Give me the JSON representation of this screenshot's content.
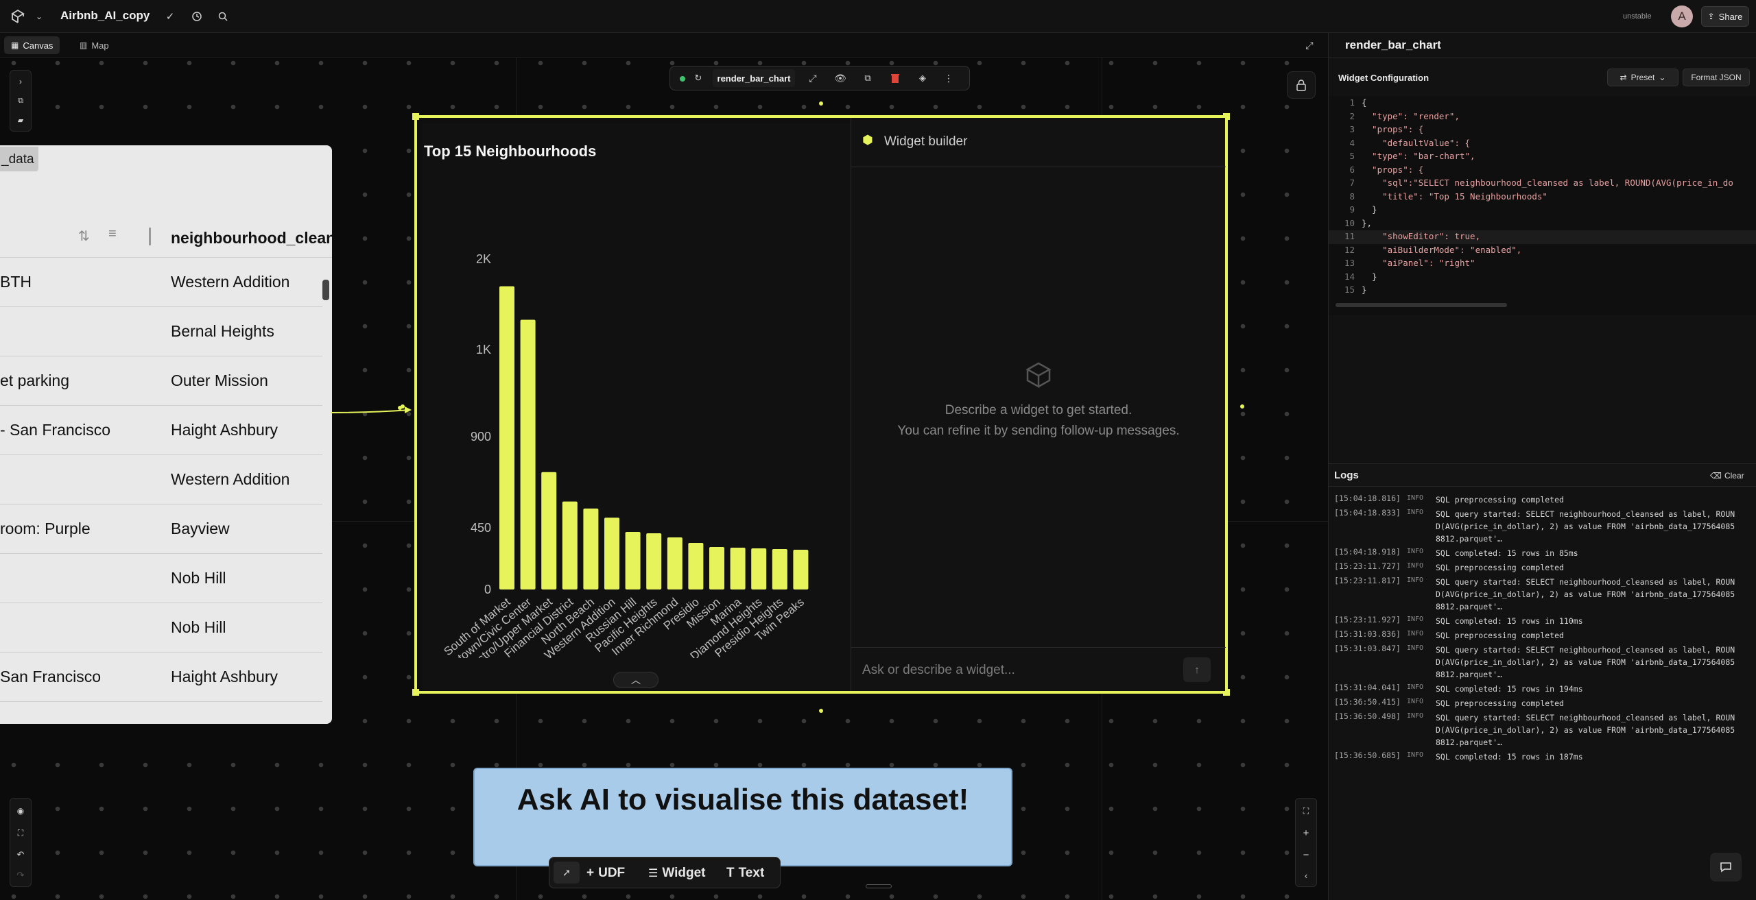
{
  "app": {
    "project_name": "Airbnb_AI_copy",
    "status_tag": "unstable",
    "avatar_letter": "A",
    "share_label": "Share"
  },
  "subbar": {
    "tabs": [
      {
        "label": "Canvas"
      },
      {
        "label": "Map"
      }
    ]
  },
  "table_card": {
    "title_fragment": "_data",
    "column_header": "neighbourhood_clean",
    "rows": [
      {
        "left": "BTH",
        "neighbourhood": "Western Addition"
      },
      {
        "left": "",
        "neighbourhood": "Bernal Heights"
      },
      {
        "left": "et parking",
        "neighbourhood": "Outer Mission"
      },
      {
        "left": "- San Francisco",
        "neighbourhood": "Haight Ashbury"
      },
      {
        "left": "",
        "neighbourhood": "Western Addition"
      },
      {
        "left": "room: Purple",
        "neighbourhood": "Bayview"
      },
      {
        "left": "",
        "neighbourhood": "Nob Hill"
      },
      {
        "left": "",
        "neighbourhood": "Nob Hill"
      },
      {
        "left": " San Francisco",
        "neighbourhood": "Haight Ashbury"
      }
    ]
  },
  "widget_toolbar": {
    "name": "render_bar_chart"
  },
  "chart_data": {
    "type": "bar",
    "title": "Top 15 Neighbourhoods",
    "categories": [
      "South of Market",
      "Downtown/Civic Center",
      "Castro/Upper Market",
      "Financial District",
      "North Beach",
      "Western Addition",
      "Russian Hill",
      "Pacific Heights",
      "Inner Richmond",
      "Presidio",
      "Mission",
      "Marina",
      "Diamond Heights",
      "Presidio Heights",
      "Twin Peaks"
    ],
    "values": [
      1700,
      1330,
      725,
      580,
      545,
      500,
      420,
      410,
      380,
      340,
      310,
      305,
      300,
      295,
      290
    ],
    "y_ticks": [
      {
        "label": "2K"
      },
      {
        "label": "1K"
      },
      {
        "label": "900"
      },
      {
        "label": "450"
      },
      {
        "label": "0"
      }
    ],
    "bar_color": "#e6f35a"
  },
  "builder": {
    "title": "Widget builder",
    "empty_line1": "Describe a widget to get started.",
    "empty_line2": "You can refine it by sending follow-up messages.",
    "input_placeholder": "Ask or describe a widget..."
  },
  "banner": {
    "text": "Ask AI to visualise this dataset!"
  },
  "bottom_tools": [
    {
      "label": "UDF"
    },
    {
      "label": "Widget"
    },
    {
      "label": "Text"
    }
  ],
  "right_panel": {
    "title": "render_bar_chart",
    "config_label": "Widget Configuration",
    "preset_label": "Preset",
    "format_label": "Format JSON",
    "code_lines": [
      "{",
      "  \"type\": \"render\",",
      "  \"props\": {",
      "    \"defaultValue\": {",
      "  \"type\": \"bar-chart\",",
      "  \"props\": {",
      "    \"sql\":\"SELECT neighbourhood_cleansed as label, ROUND(AVG(price_in_do",
      "    \"title\": \"Top 15 Neighbourhoods\"",
      "  }",
      "},",
      "    \"showEditor\": true,",
      "    \"aiBuilderMode\": \"enabled\",",
      "    \"aiPanel\": \"right\"",
      "  }",
      "}"
    ],
    "logs_label": "Logs",
    "clear_label": "Clear",
    "logs": [
      {
        "ts": "[15:04:18.816]",
        "level": "INFO",
        "msg": "SQL preprocessing completed"
      },
      {
        "ts": "[15:04:18.833]",
        "level": "INFO",
        "msg": "SQL query started: SELECT neighbourhood_cleansed as label, ROUND(AVG(price_in_dollar), 2) as value FROM 'airbnb_data_1775640858812.parquet'…"
      },
      {
        "ts": "[15:04:18.918]",
        "level": "INFO",
        "msg": "SQL completed: 15 rows in 85ms"
      },
      {
        "ts": "[15:23:11.727]",
        "level": "INFO",
        "msg": "SQL preprocessing completed"
      },
      {
        "ts": "[15:23:11.817]",
        "level": "INFO",
        "msg": "SQL query started: SELECT neighbourhood_cleansed as label, ROUND(AVG(price_in_dollar), 2) as value FROM 'airbnb_data_1775640858812.parquet'…"
      },
      {
        "ts": "[15:23:11.927]",
        "level": "INFO",
        "msg": "SQL completed: 15 rows in 110ms"
      },
      {
        "ts": "[15:31:03.836]",
        "level": "INFO",
        "msg": "SQL preprocessing completed"
      },
      {
        "ts": "[15:31:03.847]",
        "level": "INFO",
        "msg": "SQL query started: SELECT neighbourhood_cleansed as label, ROUND(AVG(price_in_dollar), 2) as value FROM 'airbnb_data_1775640858812.parquet'…"
      },
      {
        "ts": "[15:31:04.041]",
        "level": "INFO",
        "msg": "SQL completed: 15 rows in 194ms"
      },
      {
        "ts": "[15:36:50.415]",
        "level": "INFO",
        "msg": "SQL preprocessing completed"
      },
      {
        "ts": "[15:36:50.498]",
        "level": "INFO",
        "msg": "SQL query started: SELECT neighbourhood_cleansed as label, ROUND(AVG(price_in_dollar), 2) as value FROM 'airbnb_data_1775640858812.parquet'…"
      },
      {
        "ts": "[15:36:50.685]",
        "level": "INFO",
        "msg": "SQL completed: 15 rows in 187ms"
      }
    ]
  },
  "colors": {
    "accent": "#e6f35a",
    "banner": "#a7cbe8"
  }
}
